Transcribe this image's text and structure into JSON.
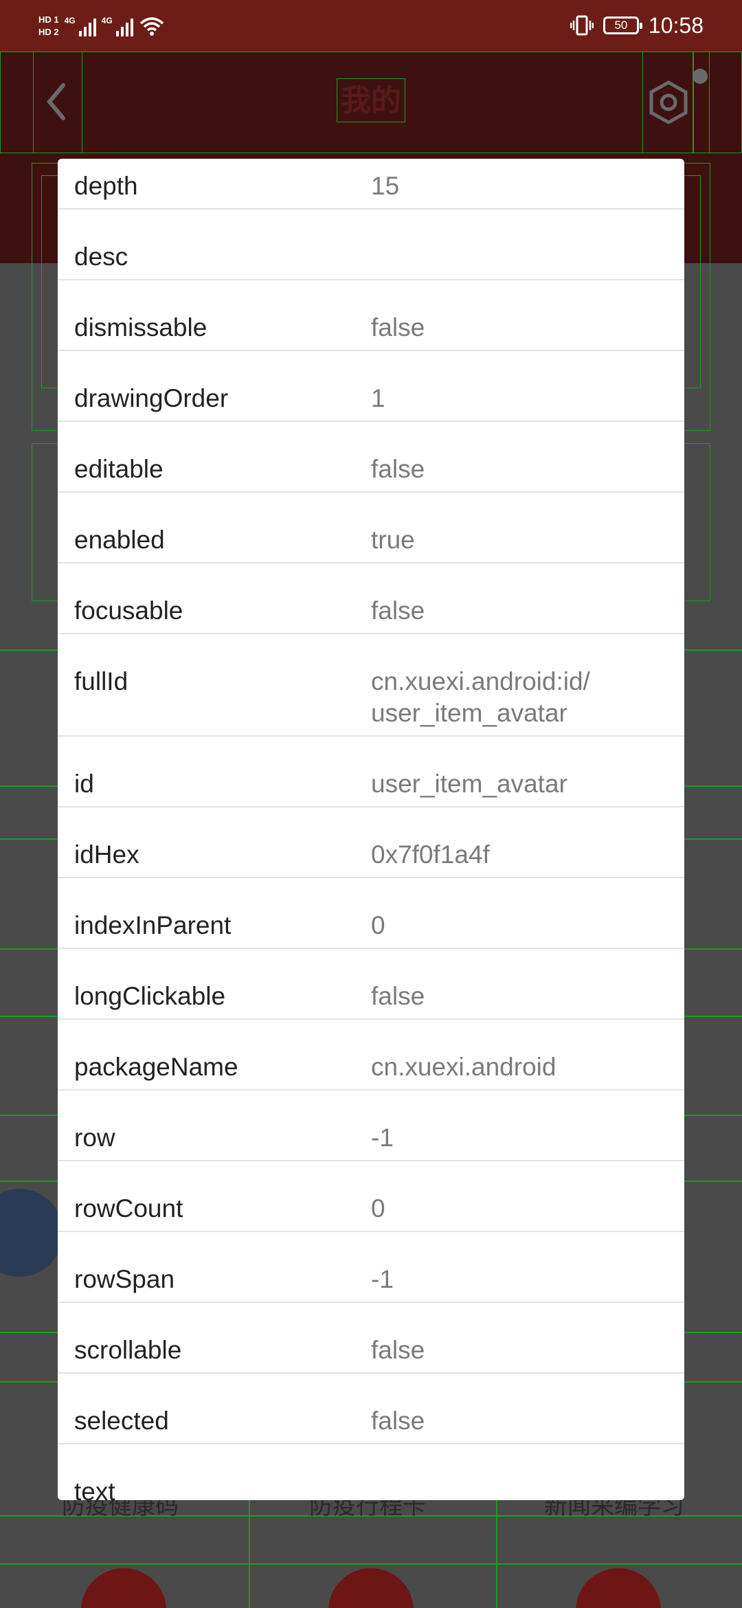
{
  "status_bar": {
    "hd1": "HD 1",
    "hd2": "HD 2",
    "net1": "4G",
    "net2": "4G",
    "battery": "50",
    "time": "10:58",
    "icons": [
      "signal-icon",
      "wifi-icon",
      "vibrate-icon",
      "battery-icon"
    ]
  },
  "app_header": {
    "title": "我的",
    "icons": [
      "back-icon",
      "settings-icon"
    ]
  },
  "bottom_nav": {
    "labels": [
      "防疫健康码",
      "防疫行程卡",
      "新闻采编学习"
    ]
  },
  "dialog": {
    "rows": [
      {
        "name": "depth",
        "value": "15"
      },
      {
        "name": "desc",
        "value": ""
      },
      {
        "name": "dismissable",
        "value": "false"
      },
      {
        "name": "drawingOrder",
        "value": "1"
      },
      {
        "name": "editable",
        "value": "false"
      },
      {
        "name": "enabled",
        "value": "true"
      },
      {
        "name": "focusable",
        "value": "false"
      },
      {
        "name": "fullId",
        "value": "cn.xuexi.android:id/\nuser_item_avatar"
      },
      {
        "name": "id",
        "value": "user_item_avatar"
      },
      {
        "name": "idHex",
        "value": "0x7f0f1a4f"
      },
      {
        "name": "indexInParent",
        "value": "0"
      },
      {
        "name": "longClickable",
        "value": "false"
      },
      {
        "name": "packageName",
        "value": "cn.xuexi.android"
      },
      {
        "name": "row",
        "value": "-1"
      },
      {
        "name": "rowCount",
        "value": "0"
      },
      {
        "name": "rowSpan",
        "value": "-1"
      },
      {
        "name": "scrollable",
        "value": "false"
      },
      {
        "name": "selected",
        "value": "false"
      },
      {
        "name": "text",
        "value": ""
      }
    ]
  },
  "colors": {
    "status_bar": "#6d1d18",
    "header_dimmed": "#3d1110",
    "overlay_bg": "#4a4a4a",
    "debug_outline": "#1f9a1f",
    "dialog_bg": "#ffffff",
    "name_text": "#222222",
    "value_text": "#7a7a7a"
  }
}
